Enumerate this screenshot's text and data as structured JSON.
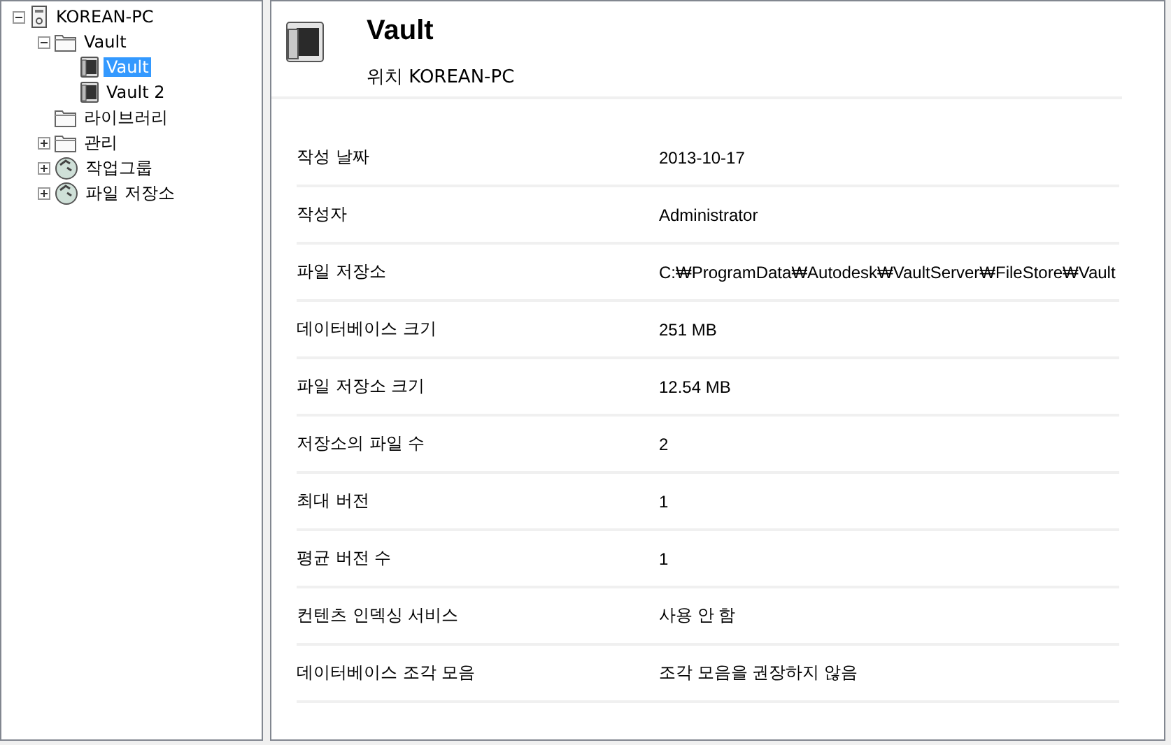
{
  "tree": [
    {
      "label": "KOREAN-PC",
      "kind": "computer",
      "expanded": true,
      "selected": false,
      "children": [
        {
          "label": "Vault",
          "kind": "folder",
          "expanded": true,
          "selected": false,
          "children": [
            {
              "label": "Vault",
              "kind": "vault",
              "selected": true
            },
            {
              "label": "Vault 2",
              "kind": "vault",
              "selected": false
            }
          ]
        },
        {
          "label": "라이브러리",
          "kind": "folder",
          "selected": false
        },
        {
          "label": "관리",
          "kind": "folder",
          "expanded": false,
          "selected": false
        },
        {
          "label": "작업그룹",
          "kind": "globe",
          "expanded": false,
          "selected": false
        },
        {
          "label": "파일 저장소",
          "kind": "globe",
          "expanded": false,
          "selected": false
        }
      ]
    }
  ],
  "header": {
    "title": "Vault",
    "subtitle": "위치 KOREAN-PC"
  },
  "properties": [
    {
      "label": "작성 날짜",
      "value": "2013-10-17"
    },
    {
      "label": "작성자",
      "value": "Administrator"
    },
    {
      "label": "파일 저장소",
      "value": "C:₩ProgramData₩Autodesk₩VaultServer₩FileStore₩Vault"
    },
    {
      "label": "데이터베이스 크기",
      "value": "251 MB"
    },
    {
      "label": "파일 저장소 크기",
      "value": "12.54 MB"
    },
    {
      "label": "저장소의 파일 수",
      "value": "2"
    },
    {
      "label": "최대 버전",
      "value": "1"
    },
    {
      "label": "평균 버전 수",
      "value": "1"
    },
    {
      "label": "컨텐츠 인덱싱 서비스",
      "value": "사용 안 함"
    },
    {
      "label": "데이터베이스 조각 모음",
      "value": "조각 모음을 권장하지 않음"
    }
  ]
}
